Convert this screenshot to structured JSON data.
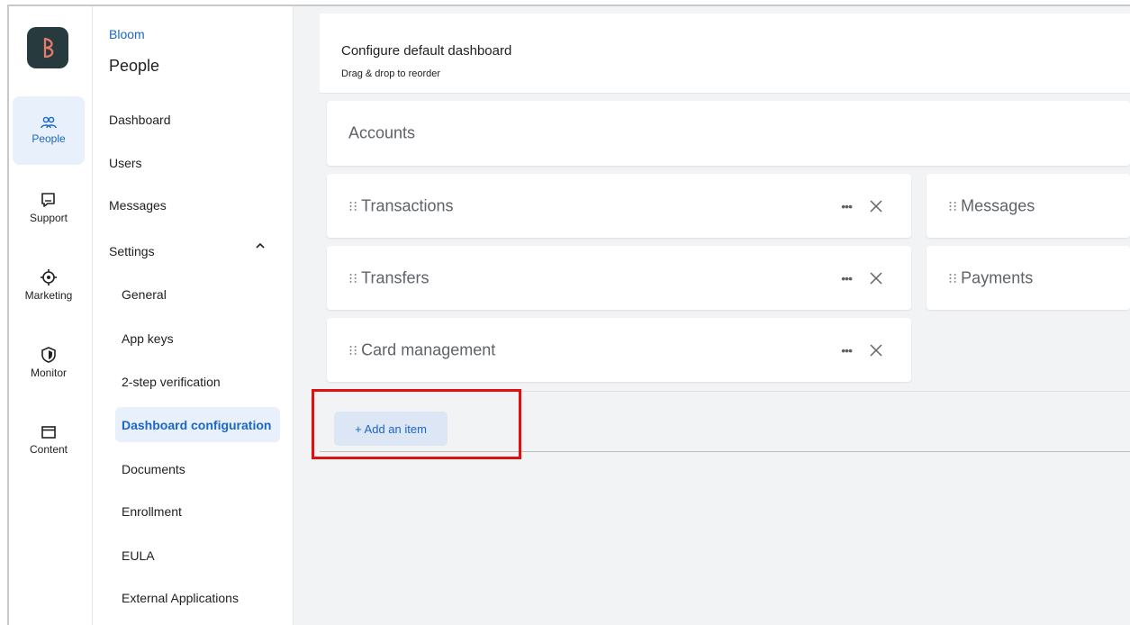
{
  "rail": {
    "items": [
      {
        "label": "People",
        "icon": "people-icon",
        "active": true
      },
      {
        "label": "Support",
        "icon": "chat-icon"
      },
      {
        "label": "Marketing",
        "icon": "target-icon"
      },
      {
        "label": "Monitor",
        "icon": "shield-icon"
      },
      {
        "label": "Content",
        "icon": "window-icon"
      }
    ]
  },
  "subnav": {
    "brand": "Bloom",
    "title": "People",
    "items": [
      {
        "label": "Dashboard"
      },
      {
        "label": "Users"
      },
      {
        "label": "Messages"
      },
      {
        "label": "Settings"
      }
    ],
    "settings_children": [
      {
        "label": "General"
      },
      {
        "label": "App keys"
      },
      {
        "label": "2-step verification"
      },
      {
        "label": "Dashboard configuration",
        "selected": true
      },
      {
        "label": "Documents"
      },
      {
        "label": "Enrollment"
      },
      {
        "label": "EULA"
      },
      {
        "label": "External Applications"
      }
    ]
  },
  "header": {
    "title": "Configure default dashboard",
    "subtitle": "Drag & drop to reorder"
  },
  "dashboard": {
    "full_width": {
      "label": "Accounts"
    },
    "left_column": [
      {
        "label": "Transactions"
      },
      {
        "label": "Transfers"
      },
      {
        "label": "Card management"
      }
    ],
    "right_column": [
      {
        "label": "Messages"
      },
      {
        "label": "Payments"
      }
    ],
    "drag_glyph": "⁝⁝",
    "more_glyph": "•••",
    "add_button_label": "+ Add an item"
  },
  "colors": {
    "accent": "#1a66c9",
    "selected_bg": "#e8f0fc",
    "highlight": "#e01010",
    "logo_bg": "#273b3e",
    "logo_fg": "#e97b6d"
  }
}
